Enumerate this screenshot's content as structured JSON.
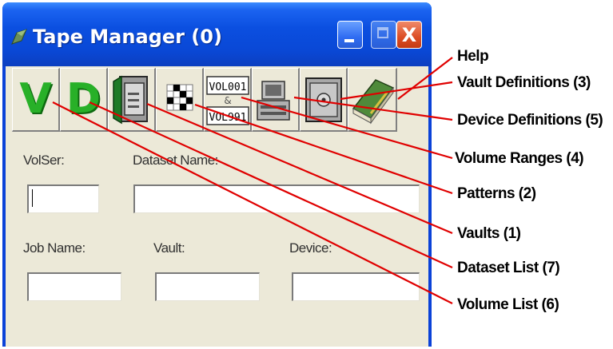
{
  "window": {
    "title": "Tape Manager (0)",
    "controls": {
      "close_glyph": "X"
    }
  },
  "toolbar": {
    "volume_list_letter": "V",
    "dataset_list_letter": "D",
    "volume_ranges_text_top": "VOL001",
    "volume_ranges_text_bottom": "VOL991",
    "volume_ranges_arrow": "&"
  },
  "form": {
    "volser_label": "VolSer:",
    "dataset_name_label": "Dataset Name:",
    "job_name_label": "Job Name:",
    "vault_label": "Vault:",
    "device_label": "Device:",
    "volser_value": "",
    "dataset_name_value": "",
    "job_name_value": "",
    "vault_value": "",
    "device_value": ""
  },
  "callouts": [
    "Help",
    "Vault Definitions (3)",
    "Device Definitions (5)",
    "Volume Ranges (4)",
    "Patterns (2)",
    "Vaults (1)",
    "Dataset List (7)",
    "Volume List (6)"
  ],
  "colors": {
    "title_bar": "#0a48d6",
    "client": "#ece9d8",
    "letter_green": "#28b028",
    "callout_line": "#e00000"
  }
}
